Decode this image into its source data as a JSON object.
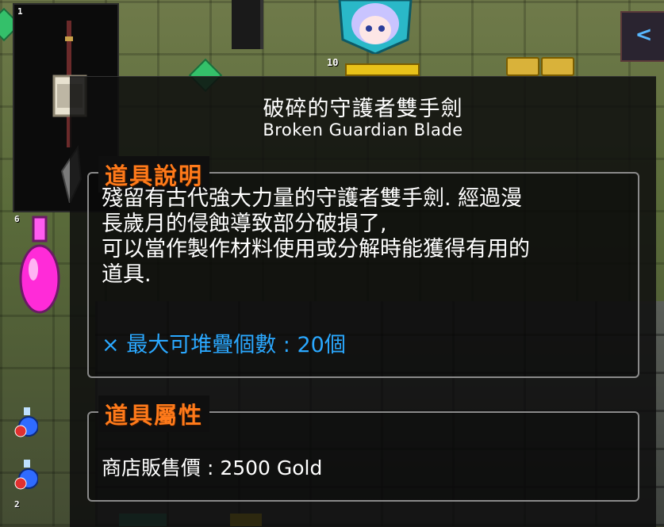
{
  "game": {
    "hud": {
      "player_level": "10",
      "inventory_slot_numbers": [
        "1",
        "6",
        "2"
      ]
    }
  },
  "tooltip": {
    "item_name_zh": "破碎的守護者雙手劍",
    "item_name_en": "Broken Guardian Blade",
    "description_section": {
      "heading": "道具說明",
      "lines": [
        "殘留有古代強大力量的守護者雙手劍. 經過漫",
        "長歲月的侵蝕導致部分破損了,",
        "可以當作製作材料使用或分解時能獲得有用的",
        "道具."
      ],
      "stack_limit": "× 最大可堆疊個數 : 20個"
    },
    "attributes_section": {
      "heading": "道具屬性",
      "shop_price": "商店販售價 : 2500 Gold"
    }
  },
  "colors": {
    "heading": "#ff7a1a",
    "stack_note": "#2aa8ff",
    "text": "#ffffff",
    "panel_bg": "#0e0e0e"
  },
  "icons": [
    "sword-icon",
    "potion-icon",
    "mana-potion-icon",
    "clock-icon",
    "character-portrait-icon",
    "nav-arrow-icon"
  ]
}
